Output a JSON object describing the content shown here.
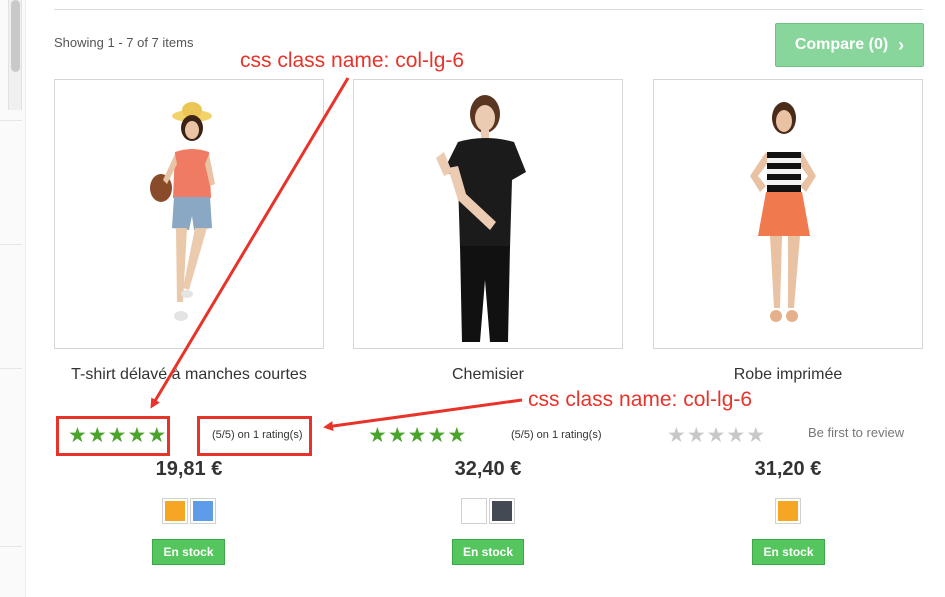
{
  "listing": {
    "showing_text": "Showing 1 - 7 of 7 items",
    "compare_label": "Compare (0)",
    "compare_icon": "chevron-right-icon",
    "accent_color": "#88d69b"
  },
  "products": [
    {
      "name": "T-shirt délavé à manches courtes",
      "rating": 5,
      "rating_text": "(5/5) on 1 rating(s)",
      "price": "19,81 €",
      "colors": [
        "#f5a623",
        "#5e9be8"
      ],
      "stock": "En stock"
    },
    {
      "name": "Chemisier",
      "rating": 5,
      "rating_text": "(5/5) on 1 rating(s)",
      "price": "32,40 €",
      "colors": [
        "#ffffff",
        "#434a54"
      ],
      "stock": "En stock"
    },
    {
      "name": "Robe imprimée",
      "rating": 0,
      "review_text": "Be first to review",
      "price": "31,20 €",
      "colors": [
        "#f5a623"
      ],
      "stock": "En stock"
    }
  ],
  "annotations": {
    "top": "css class name: col-lg-6",
    "right": "css class name: col-lg-6",
    "color": "#e8332a"
  }
}
